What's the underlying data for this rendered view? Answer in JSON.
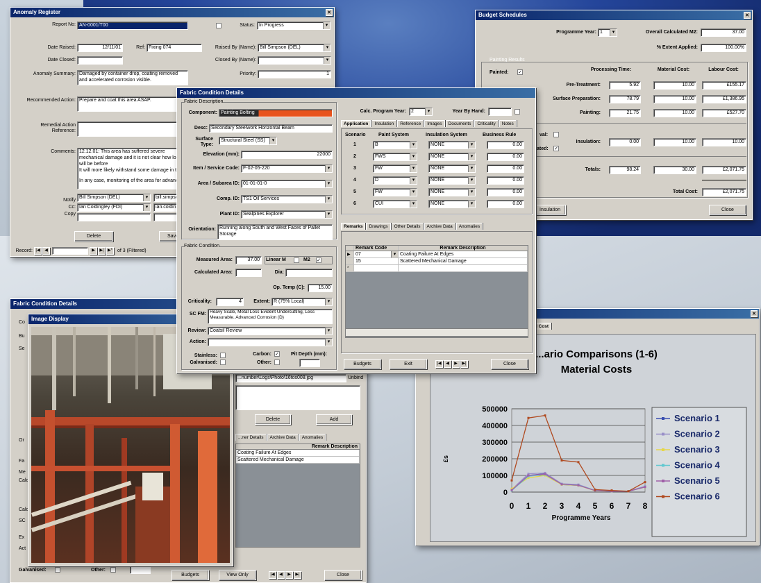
{
  "anomaly": {
    "title": "Anomaly Register",
    "report_no_label": "Report No:",
    "report_no": "AN-0001/T00",
    "status_label": "Status:",
    "status": "In Progress",
    "date_raised_label": "Date Raised:",
    "date_raised": "12/11/01",
    "ref_label": "Ref:",
    "ref": "Fixing 074",
    "raised_by_label": "Raised By (Name):",
    "raised_by": "Bill Simpson (DEL)",
    "date_closed_label": "Date Closed:",
    "closed_by_label": "Closed By (Name):",
    "anomaly_label": "Anomaly Summary:",
    "anomaly_text": "Damaged by container drop, coating removed and accelerated corrosion visible.",
    "priority_label": "Priority:",
    "priority": "1",
    "recommended_label": "Recommended Action:",
    "recommended": "Prepare and coat this area ASAP.",
    "remedial_label": "Remedial Action Reference:",
    "comments_label": "Comments:",
    "comments_1": "12.12.01: This area has suffered severe mechanical damage and it is not clear how long it will be before",
    "comments_2": "It will more likely withstand some damage in the",
    "comments_3": "In any case, monitoring of the area for advanced",
    "notify_label": "Notify",
    "cc_label": "Cc:",
    "copy_label": "Copy",
    "notify_rows": [
      "Bill Simpson (DEL)",
      "bill.simpson@...",
      "Ian Coldingley (FDI)",
      "ian.coldingley@..."
    ],
    "delete_label": "Delete",
    "save_label": "Save",
    "record_label": "Record:",
    "record_of": "of 3 (Filtered)"
  },
  "budget": {
    "title": "Budget Schedules",
    "programme_year_label": "Programme Year:",
    "programme_year": "1",
    "overall_m2_label": "Overall Calculated M2:",
    "overall_m2": "37.00",
    "extent_label": "% Extent Applied:",
    "extent": "100.00%",
    "painting_results": "Painting Results",
    "painted_label": "Painted:",
    "col_processing": "Processing Time:",
    "col_material": "Material Cost:",
    "col_labour": "Labour Cost:",
    "rows": [
      {
        "label": "Pre-Treatment:",
        "time": "5.92",
        "material": "10.00",
        "labour": "£155.17"
      },
      {
        "label": "Surface Preparation:",
        "time": "78.79",
        "material": "10.00",
        "labour": "£1,386.95"
      },
      {
        "label": "Painting:",
        "time": "21.75",
        "material": "10.00",
        "labour": "£527.70"
      }
    ],
    "val_label": "val:",
    "ated_label": "ated:",
    "insulation_label": "Insulation:",
    "insulation": [
      "0.00",
      "10.00",
      "10.00"
    ],
    "totals_label": "Totals:",
    "totals": [
      "98.24",
      "30.00",
      "£2,071.75"
    ],
    "total_cost_label": "Total Cost:",
    "total_cost": "£2,071.75",
    "insulation_btn": "Insulation",
    "close_label": "Close"
  },
  "fabric": {
    "title": "Fabric Condition Details",
    "desc_heading": "Fabric Description",
    "component_label": "Component:",
    "component": "Painting Bolting",
    "desc_label": "Desc:",
    "desc": "Secondary Steelwork Horizontal Beam",
    "surface_label": "Surface Type:",
    "surface": "Structural Steel (SS)",
    "elevation_label": "Elevation (mm):",
    "elevation": "22000",
    "item_label": "Item / Service Code:",
    "item": "F-02-05-220",
    "area_label": "Area / Subarea ID:",
    "area": "01-01-01-0",
    "comp_id_label": "Comp. ID:",
    "comp_id": "TS1 Oil Services",
    "plant_label": "Plant ID:",
    "plant": "Sealpines Explorer",
    "orientation_label": "Orientation:",
    "orientation": "Running along South and West Faces of Pallet Storage",
    "condition_heading": "Fabric Condition",
    "measured_label": "Measured Area:",
    "measured": "37.00",
    "linear_label": "Linear M",
    "m2_label": "M2",
    "calculated_label": "Calculated Area:",
    "dia_label": "Dia:",
    "op_temp_label": "Op. Temp (C):",
    "op_temp": "15.00",
    "criticality_label": "Criticality:",
    "criticality": "4",
    "extent_label": "Extent:",
    "extent": "R (75% Local)",
    "sc_fm_label": "SC FM:",
    "sc_fm": "Heavy Scale, Metal Loss Evident Undercutting, Less Measurable. Advanced Corrosion (D)",
    "review_label": "Review:",
    "review": "Coatsil Review",
    "action_label": "Action:",
    "stainless_label": "Stainless:",
    "galvanised_label": "Galvanised:",
    "carbon_label": "Carbon:",
    "other_label": "Other:",
    "pit_label": "Pit Depth (mm):",
    "calc_label": "Calc. Program Year:",
    "calc_year": "2",
    "year_by_hand_label": "Year By Hand:",
    "tabs1": [
      "Application",
      "Insulation",
      "Reference",
      "Images",
      "Documents",
      "Criticality",
      "Notes"
    ],
    "scen_header": [
      "Scenario",
      "Paint System",
      "Insulation System",
      "Business Rule"
    ],
    "scenarios": [
      {
        "n": "1",
        "paint": "B",
        "ins": "NONE",
        "rule": "0.00"
      },
      {
        "n": "2",
        "paint": "FWS",
        "ins": "NONE",
        "rule": "0.00"
      },
      {
        "n": "3",
        "paint": "FW",
        "ins": "NONE",
        "rule": "0.00"
      },
      {
        "n": "4",
        "paint": "D",
        "ins": "NONE",
        "rule": "0.00"
      },
      {
        "n": "5",
        "paint": "FW",
        "ins": "NONE",
        "rule": "0.00"
      },
      {
        "n": "6",
        "paint": "CUI",
        "ins": "NONE",
        "rule": "0.00"
      }
    ],
    "tabs2": [
      "Remarks",
      "Drawings",
      "Other Details",
      "Archive Data",
      "Anomalies"
    ],
    "remarks_header": [
      "Remark Code",
      "Remark Description"
    ],
    "remarks": [
      {
        "code": "07",
        "desc": "Coating Failure At Edges"
      },
      {
        "code": "15",
        "desc": "Scattered Mechanical Damage"
      }
    ],
    "budgets_label": "Budgets",
    "exit_label": "Exit",
    "close_label": "Close"
  },
  "image_win": {
    "back_title": "Fabric Condition Details",
    "title": "Image Display",
    "path": "...number\\Logs\\Photo\\16tos008.jpg",
    "unbox": "Unbind",
    "delete_label": "Delete",
    "add_label": "Add",
    "tabs": [
      "...ner Details",
      "Archive Data",
      "Anomalies"
    ],
    "remark_header": "Remark Description",
    "remarks": [
      "Coating Failure At Edges",
      "Scattered Mechanical Damage"
    ],
    "galvanised_label": "Galvanised:",
    "other_label": "Other:",
    "budgets_label": "Budgets",
    "view_only_label": "View Only",
    "close_label": "Close",
    "side_labels": [
      "Co",
      "Bu",
      "Se",
      "Or",
      "Fa",
      "Me",
      "Calc",
      "Calc",
      "SC",
      "Ex",
      "Act"
    ]
  },
  "chart_win": {
    "tab": "...al Cost",
    "title_line1": "...ario Comparisons (1-6)",
    "title_line2": "Material Costs",
    "ylabel": "£s",
    "xlabel": "Programme Years"
  },
  "chart_data": {
    "type": "line",
    "title": "...ario Comparisons (1-6) Material Costs",
    "xlabel": "Programme Years",
    "ylabel": "£s",
    "x": [
      0,
      1,
      2,
      3,
      4,
      5,
      6,
      7,
      8
    ],
    "ylim": [
      0,
      500000
    ],
    "yticks": [
      0,
      100000,
      200000,
      300000,
      400000,
      500000
    ],
    "grid": true,
    "legend": "right",
    "series": [
      {
        "name": "Scenario 1",
        "color": "#3a4fb0",
        "values": [
          10000,
          100000,
          110000,
          45000,
          40000,
          10000,
          5000,
          5000,
          30000
        ]
      },
      {
        "name": "Scenario 2",
        "color": "#9a90c8",
        "values": [
          15000,
          110000,
          115000,
          50000,
          45000,
          10000,
          5000,
          5000,
          35000
        ]
      },
      {
        "name": "Scenario 3",
        "color": "#e6d64a",
        "values": [
          20000,
          85000,
          100000,
          45000,
          40000,
          8000,
          5000,
          5000,
          30000
        ]
      },
      {
        "name": "Scenario 4",
        "color": "#60c8d0",
        "values": [
          10000,
          95000,
          105000,
          48000,
          42000,
          10000,
          5000,
          5000,
          32000
        ]
      },
      {
        "name": "Scenario 5",
        "color": "#a060a8",
        "values": [
          12000,
          100000,
          108000,
          47000,
          41000,
          9000,
          5000,
          5000,
          31000
        ]
      },
      {
        "name": "Scenario 6",
        "color": "#b04a20",
        "values": [
          70000,
          445000,
          460000,
          190000,
          180000,
          15000,
          10000,
          5000,
          60000
        ]
      }
    ]
  }
}
